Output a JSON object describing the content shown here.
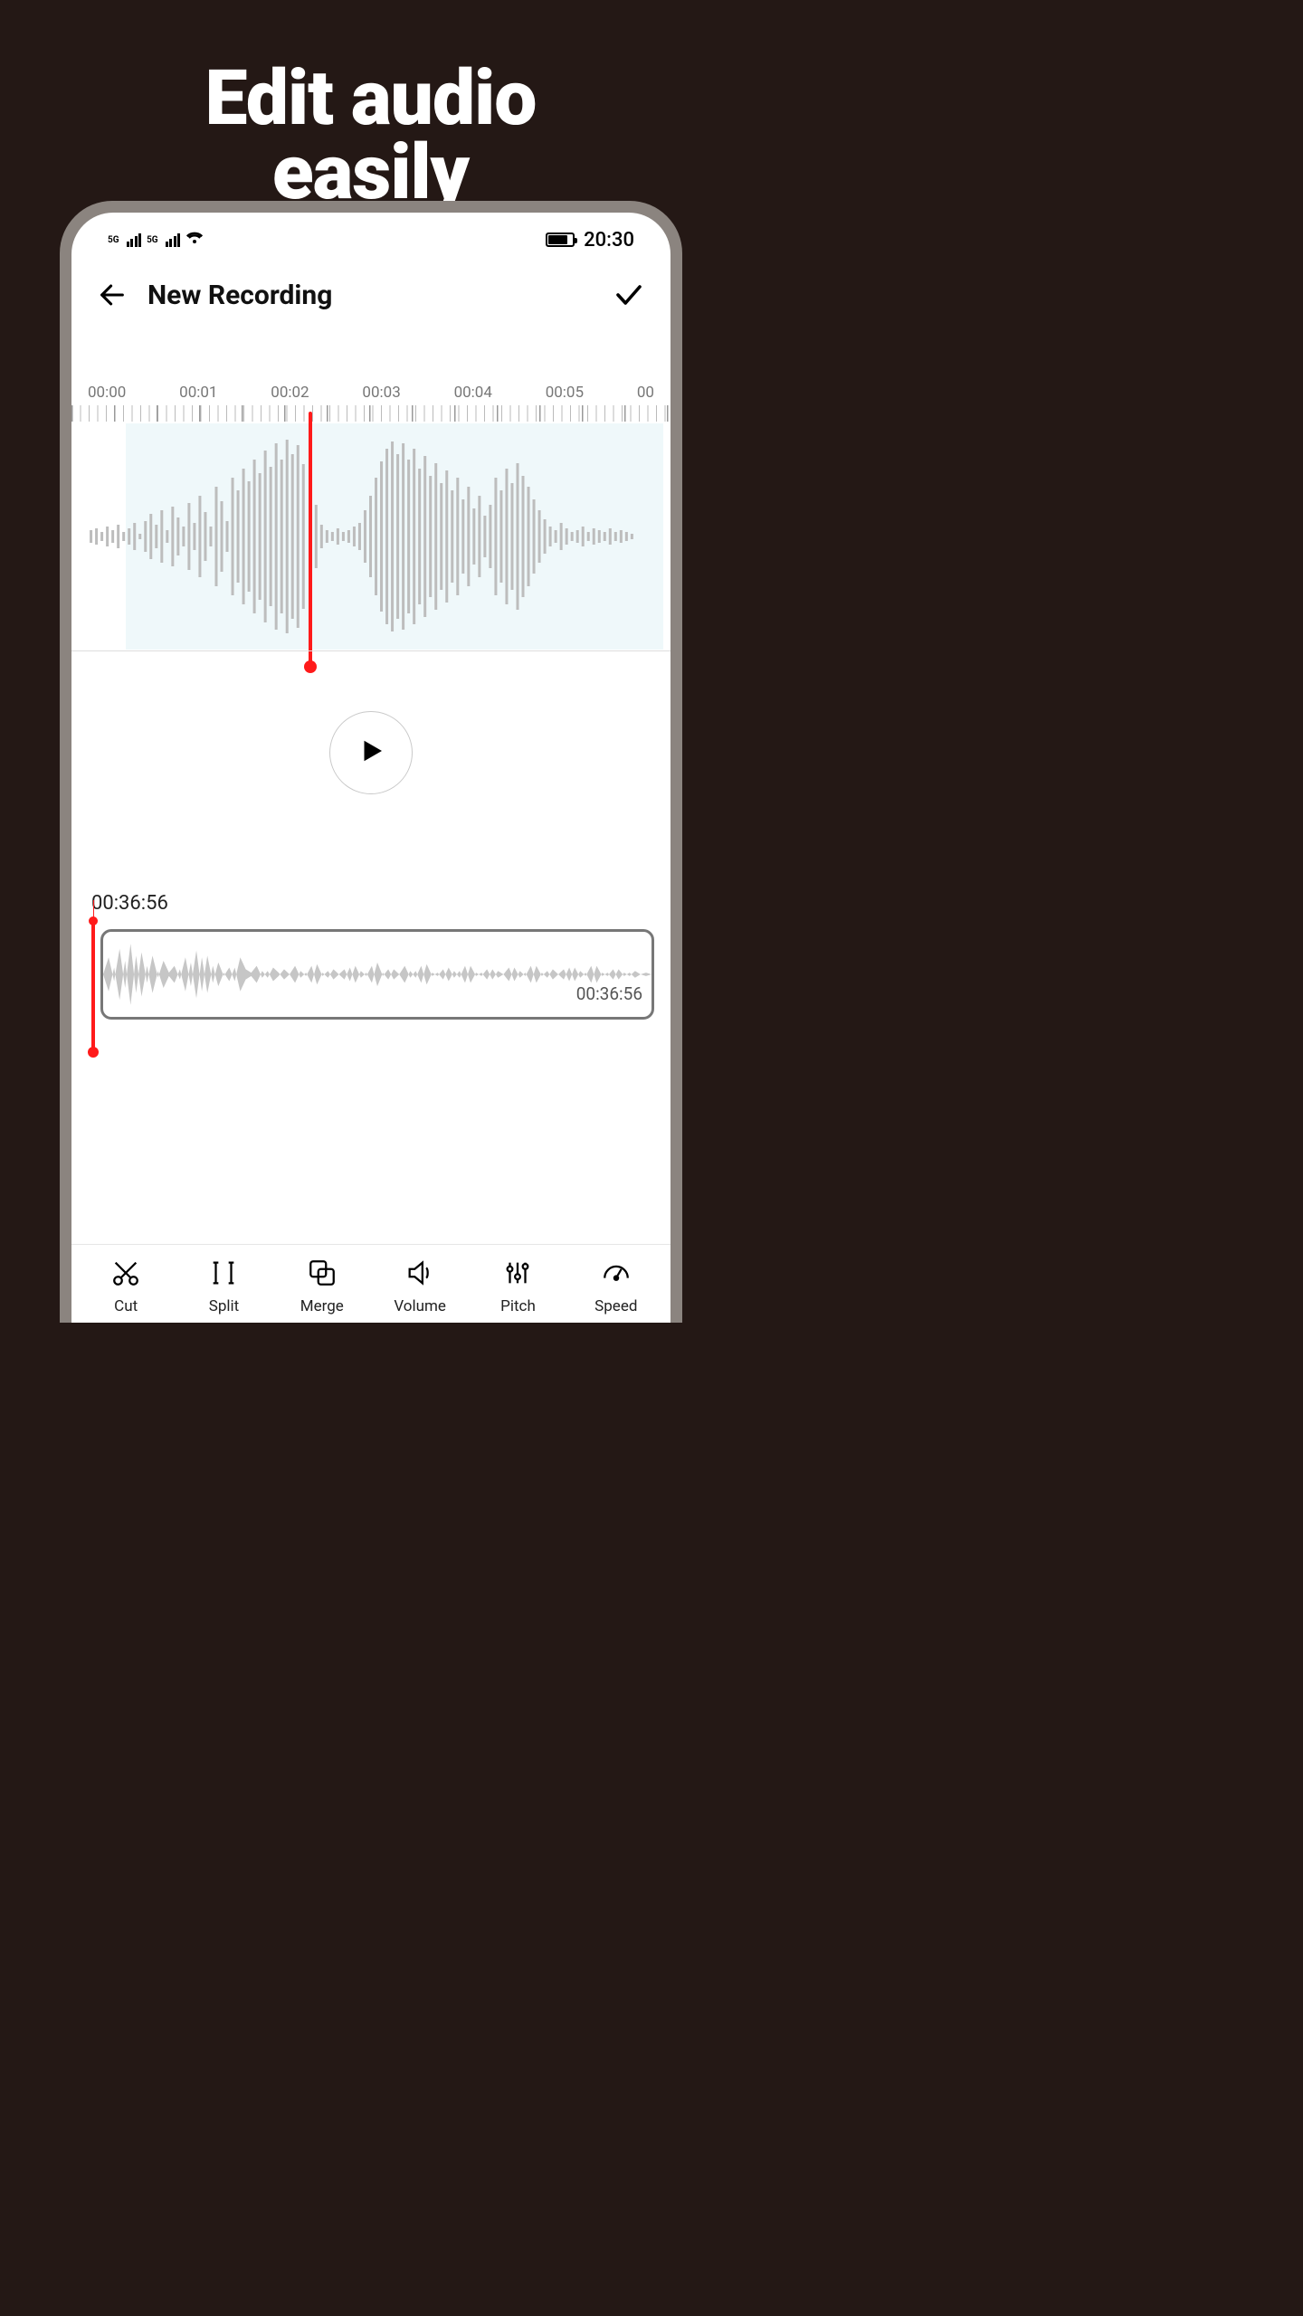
{
  "headline_line1": "Edit audio",
  "headline_line2": "easily",
  "status": {
    "time": "20:30"
  },
  "header": {
    "title": "New Recording"
  },
  "timeline": {
    "ticks": [
      "00:00",
      "00:01",
      "00:02",
      "00:03",
      "00:04",
      "00:05",
      "00"
    ]
  },
  "clip": {
    "position_time": "00:36:56",
    "duration": "00:36:56"
  },
  "tools": {
    "cut": "Cut",
    "split": "Split",
    "merge": "Merge",
    "volume": "Volume",
    "pitch": "Pitch",
    "speed": "Speed"
  }
}
